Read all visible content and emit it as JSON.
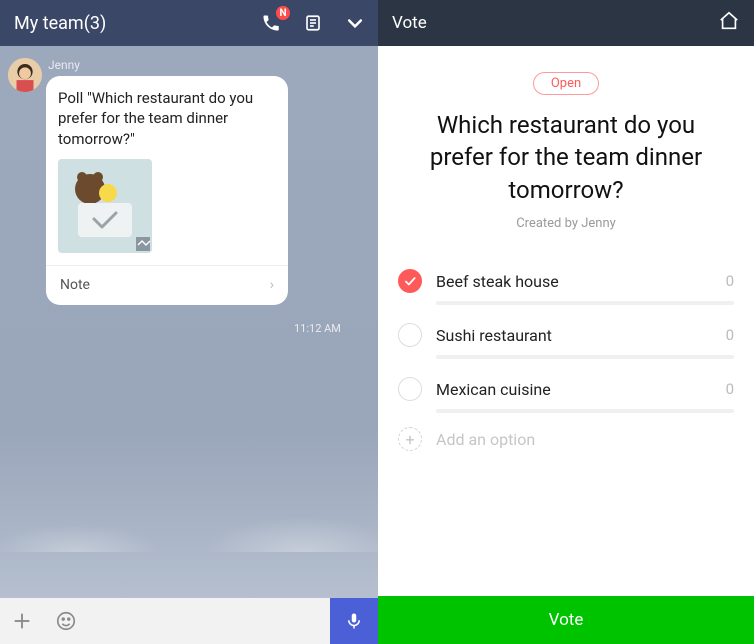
{
  "chat": {
    "title": "My team(3)",
    "call_badge": "N",
    "sender": "Jenny",
    "message_text": "Poll \"Which restaurant do you prefer for the team dinner tomorrow?\"",
    "note_label": "Note",
    "timestamp": "11:12 AM"
  },
  "vote": {
    "header_title": "Vote",
    "status_label": "Open",
    "question": "Which restaurant do you prefer for the team dinner tomorrow?",
    "created_by": "Created by Jenny",
    "options": [
      {
        "label": "Beef steak house",
        "count": "0",
        "checked": true
      },
      {
        "label": "Sushi restaurant",
        "count": "0",
        "checked": false
      },
      {
        "label": "Mexican cuisine",
        "count": "0",
        "checked": false
      }
    ],
    "add_option_label": "Add an option",
    "button_label": "Vote"
  }
}
